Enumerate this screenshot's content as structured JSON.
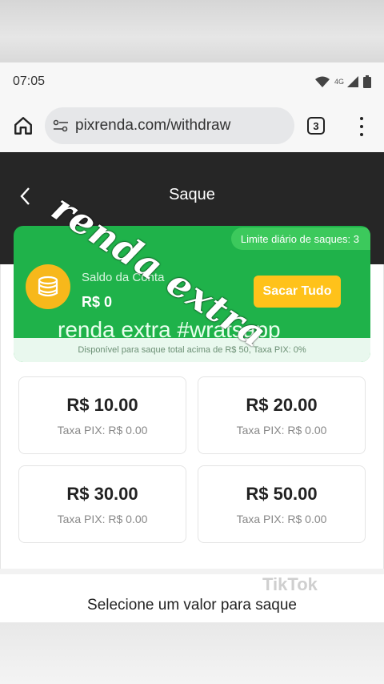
{
  "status_bar": {
    "time": "07:05",
    "network": "4G"
  },
  "browser": {
    "url": "pixrenda.com/withdraw",
    "tab_count": "3"
  },
  "header": {
    "title": "Saque"
  },
  "balance_card": {
    "limit_text": "Limite diário de saques: 3",
    "balance_label": "Saldo da Conta",
    "balance_value": "R$ 0",
    "withdraw_all_label": "Sacar Tudo",
    "watermark": "renda extra #wratsapp",
    "available_text": "Disponível para saque total acima de R$ 50, Taxa PIX: 0%"
  },
  "amounts": [
    {
      "value": "R$ 10.00",
      "fee": "Taxa PIX: R$ 0.00"
    },
    {
      "value": "R$ 20.00",
      "fee": "Taxa PIX: R$ 0.00"
    },
    {
      "value": "R$ 30.00",
      "fee": "Taxa PIX: R$ 0.00"
    },
    {
      "value": "R$ 50.00",
      "fee": "Taxa PIX: R$ 0.00"
    }
  ],
  "overlay_text": "renda extra",
  "bottom": {
    "prompt": "Selecione um valor para saque",
    "tiktok_mark": "TikTok"
  },
  "colors": {
    "green": "#1fb24a",
    "coin": "#f7b81b",
    "button": "#ffc21a",
    "header": "#262626"
  }
}
